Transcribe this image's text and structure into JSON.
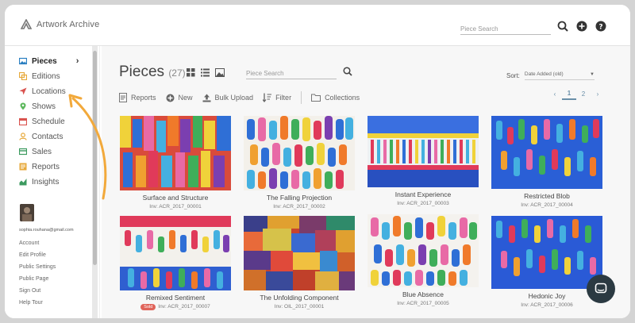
{
  "app": {
    "name": "Artwork Archive"
  },
  "topbar": {
    "search_placeholder": "Piece Search",
    "search_icon": "search-icon",
    "add_icon": "plus-circle-icon",
    "help_icon": "help-circle-icon"
  },
  "sidebar": {
    "items": [
      {
        "label": "Pieces",
        "icon": "image-icon",
        "color": "#2a7fc1",
        "active": true
      },
      {
        "label": "Editions",
        "icon": "editions-icon",
        "color": "#e7a93b"
      },
      {
        "label": "Locations",
        "icon": "location-arrow-icon",
        "color": "#d9534f"
      },
      {
        "label": "Shows",
        "icon": "map-pin-icon",
        "color": "#5cb85c"
      },
      {
        "label": "Schedule",
        "icon": "calendar-icon",
        "color": "#d9534f"
      },
      {
        "label": "Contacts",
        "icon": "contact-icon",
        "color": "#e7a93b"
      },
      {
        "label": "Sales",
        "icon": "sales-icon",
        "color": "#3c9a5f"
      },
      {
        "label": "Reports",
        "icon": "reports-icon",
        "color": "#e7a93b"
      },
      {
        "label": "Insights",
        "icon": "insights-icon",
        "color": "#3c9a5f"
      }
    ],
    "email": "sophia.rouhana@gmail.com",
    "account_links": [
      "Account",
      "Edit Profile",
      "Public Settings",
      "Public Page",
      "Sign Out",
      "Help Tour"
    ]
  },
  "main": {
    "title": "Pieces",
    "count": "(27)",
    "search_placeholder": "Piece Search",
    "sort_label": "Sort:",
    "sort_value": "Date Added (old)",
    "toolbar": {
      "reports": "Reports",
      "new": "New",
      "bulk_upload": "Bulk Upload",
      "filter": "Filter",
      "collections": "Collections"
    },
    "pager": {
      "prev": "‹",
      "pages": [
        "1",
        "2"
      ],
      "current": "1",
      "next": "›"
    }
  },
  "pieces": [
    {
      "title": "Surface and Structure",
      "inv": "Inv: ACR_2017_00001",
      "sold": false
    },
    {
      "title": "The Falling Projection",
      "inv": "Inv: ACR_2017_00002",
      "sold": false
    },
    {
      "title": "Instant Experience",
      "inv": "Inv: ACR_2017_00003",
      "sold": false
    },
    {
      "title": "Restricted Blob",
      "inv": "Inv: ACR_2017_00004",
      "sold": false
    },
    {
      "title": "Remixed Sentiment",
      "inv": "Inv: ACR_2017_00007",
      "sold": true,
      "sold_label": "Sold"
    },
    {
      "title": "The Unfolding Component",
      "inv": "Inv: OIL_2017_00001",
      "sold": false
    },
    {
      "title": "Blue Absence",
      "inv": "Inv: ACR_2017_00005",
      "sold": false
    },
    {
      "title": "Hedonic Joy",
      "inv": "Inv: ACR_2017_00006",
      "sold": false
    }
  ],
  "colors": {
    "accent": "#6a8fa8",
    "sold": "#e0645a",
    "arrow": "#f2a93b",
    "chat": "#2b3a42"
  }
}
